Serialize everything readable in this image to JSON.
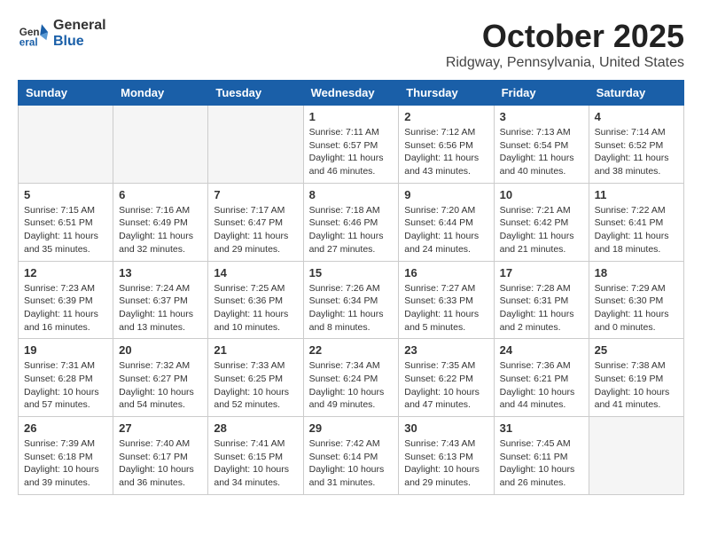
{
  "header": {
    "logo": {
      "general": "General",
      "blue": "Blue"
    },
    "title": "October 2025",
    "location": "Ridgway, Pennsylvania, United States"
  },
  "days_of_week": [
    "Sunday",
    "Monday",
    "Tuesday",
    "Wednesday",
    "Thursday",
    "Friday",
    "Saturday"
  ],
  "weeks": [
    [
      {
        "day": "",
        "empty": true
      },
      {
        "day": "",
        "empty": true
      },
      {
        "day": "",
        "empty": true
      },
      {
        "day": "1",
        "sunrise": "7:11 AM",
        "sunset": "6:57 PM",
        "daylight": "11 hours and 46 minutes."
      },
      {
        "day": "2",
        "sunrise": "7:12 AM",
        "sunset": "6:56 PM",
        "daylight": "11 hours and 43 minutes."
      },
      {
        "day": "3",
        "sunrise": "7:13 AM",
        "sunset": "6:54 PM",
        "daylight": "11 hours and 40 minutes."
      },
      {
        "day": "4",
        "sunrise": "7:14 AM",
        "sunset": "6:52 PM",
        "daylight": "11 hours and 38 minutes."
      }
    ],
    [
      {
        "day": "5",
        "sunrise": "7:15 AM",
        "sunset": "6:51 PM",
        "daylight": "11 hours and 35 minutes."
      },
      {
        "day": "6",
        "sunrise": "7:16 AM",
        "sunset": "6:49 PM",
        "daylight": "11 hours and 32 minutes."
      },
      {
        "day": "7",
        "sunrise": "7:17 AM",
        "sunset": "6:47 PM",
        "daylight": "11 hours and 29 minutes."
      },
      {
        "day": "8",
        "sunrise": "7:18 AM",
        "sunset": "6:46 PM",
        "daylight": "11 hours and 27 minutes."
      },
      {
        "day": "9",
        "sunrise": "7:20 AM",
        "sunset": "6:44 PM",
        "daylight": "11 hours and 24 minutes."
      },
      {
        "day": "10",
        "sunrise": "7:21 AM",
        "sunset": "6:42 PM",
        "daylight": "11 hours and 21 minutes."
      },
      {
        "day": "11",
        "sunrise": "7:22 AM",
        "sunset": "6:41 PM",
        "daylight": "11 hours and 18 minutes."
      }
    ],
    [
      {
        "day": "12",
        "sunrise": "7:23 AM",
        "sunset": "6:39 PM",
        "daylight": "11 hours and 16 minutes."
      },
      {
        "day": "13",
        "sunrise": "7:24 AM",
        "sunset": "6:37 PM",
        "daylight": "11 hours and 13 minutes."
      },
      {
        "day": "14",
        "sunrise": "7:25 AM",
        "sunset": "6:36 PM",
        "daylight": "11 hours and 10 minutes."
      },
      {
        "day": "15",
        "sunrise": "7:26 AM",
        "sunset": "6:34 PM",
        "daylight": "11 hours and 8 minutes."
      },
      {
        "day": "16",
        "sunrise": "7:27 AM",
        "sunset": "6:33 PM",
        "daylight": "11 hours and 5 minutes."
      },
      {
        "day": "17",
        "sunrise": "7:28 AM",
        "sunset": "6:31 PM",
        "daylight": "11 hours and 2 minutes."
      },
      {
        "day": "18",
        "sunrise": "7:29 AM",
        "sunset": "6:30 PM",
        "daylight": "11 hours and 0 minutes."
      }
    ],
    [
      {
        "day": "19",
        "sunrise": "7:31 AM",
        "sunset": "6:28 PM",
        "daylight": "10 hours and 57 minutes."
      },
      {
        "day": "20",
        "sunrise": "7:32 AM",
        "sunset": "6:27 PM",
        "daylight": "10 hours and 54 minutes."
      },
      {
        "day": "21",
        "sunrise": "7:33 AM",
        "sunset": "6:25 PM",
        "daylight": "10 hours and 52 minutes."
      },
      {
        "day": "22",
        "sunrise": "7:34 AM",
        "sunset": "6:24 PM",
        "daylight": "10 hours and 49 minutes."
      },
      {
        "day": "23",
        "sunrise": "7:35 AM",
        "sunset": "6:22 PM",
        "daylight": "10 hours and 47 minutes."
      },
      {
        "day": "24",
        "sunrise": "7:36 AM",
        "sunset": "6:21 PM",
        "daylight": "10 hours and 44 minutes."
      },
      {
        "day": "25",
        "sunrise": "7:38 AM",
        "sunset": "6:19 PM",
        "daylight": "10 hours and 41 minutes."
      }
    ],
    [
      {
        "day": "26",
        "sunrise": "7:39 AM",
        "sunset": "6:18 PM",
        "daylight": "10 hours and 39 minutes."
      },
      {
        "day": "27",
        "sunrise": "7:40 AM",
        "sunset": "6:17 PM",
        "daylight": "10 hours and 36 minutes."
      },
      {
        "day": "28",
        "sunrise": "7:41 AM",
        "sunset": "6:15 PM",
        "daylight": "10 hours and 34 minutes."
      },
      {
        "day": "29",
        "sunrise": "7:42 AM",
        "sunset": "6:14 PM",
        "daylight": "10 hours and 31 minutes."
      },
      {
        "day": "30",
        "sunrise": "7:43 AM",
        "sunset": "6:13 PM",
        "daylight": "10 hours and 29 minutes."
      },
      {
        "day": "31",
        "sunrise": "7:45 AM",
        "sunset": "6:11 PM",
        "daylight": "10 hours and 26 minutes."
      },
      {
        "day": "",
        "empty": true
      }
    ]
  ]
}
